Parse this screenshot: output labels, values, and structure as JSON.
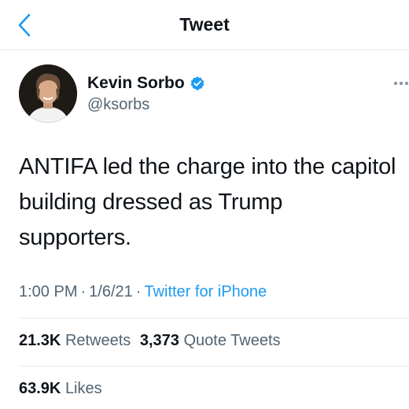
{
  "header": {
    "title": "Tweet"
  },
  "author": {
    "name": "Kevin Sorbo",
    "handle": "@ksorbs",
    "verified": true
  },
  "tweet": {
    "text": "ANTIFA led the charge into the capitol building dressed as Trump supporters.",
    "time": "1:00 PM",
    "date": "1/6/21",
    "separator": "·",
    "source": "Twitter for iPhone"
  },
  "stats": {
    "retweets_count": "21.3K",
    "retweets_label": "Retweets",
    "quotes_count": "3,373",
    "quotes_label": "Quote Tweets",
    "likes_count": "63.9K",
    "likes_label": "Likes"
  },
  "colors": {
    "accent": "#1d9bf0",
    "secondary_text": "#536471",
    "divider": "#e6ecf0"
  },
  "icons": {
    "back": "chevron-left-icon",
    "verified": "verified-badge-icon",
    "more": "more-horizontal-icon"
  }
}
